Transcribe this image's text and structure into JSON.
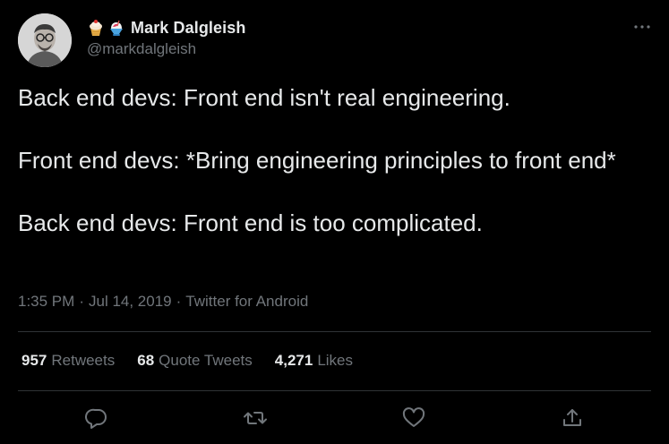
{
  "author": {
    "display_name": "Mark Dalgleish",
    "handle": "@markdalgleish",
    "name_emojis": [
      "cupcake-emoji",
      "shaved-ice-emoji"
    ]
  },
  "tweet": {
    "paragraphs": [
      "Back end devs: Front end isn't real engineering.",
      "Front end devs: *Bring engineering principles to front end*",
      "Back end devs: Front end is too complicated."
    ],
    "time": "1:35 PM",
    "date": "Jul 14, 2019",
    "source": "Twitter for Android"
  },
  "stats": {
    "retweets_count": "957",
    "retweets_label": "Retweets",
    "quotes_count": "68",
    "quotes_label": "Quote Tweets",
    "likes_count": "4,271",
    "likes_label": "Likes"
  },
  "actions": [
    "reply-icon",
    "retweet-icon",
    "like-icon",
    "share-icon"
  ],
  "more_icon": "more-icon",
  "colors": {
    "background": "#000000",
    "primary_text": "#e7e9ea",
    "secondary_text": "#71767b",
    "divider": "#2f3336"
  }
}
